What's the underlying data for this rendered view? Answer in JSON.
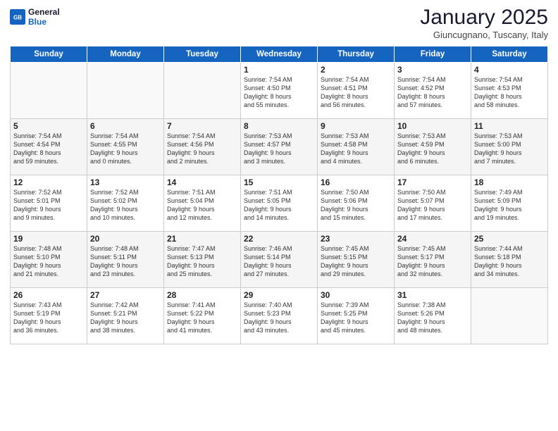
{
  "header": {
    "logo_line1": "General",
    "logo_line2": "Blue",
    "month": "January 2025",
    "location": "Giuncugnano, Tuscany, Italy"
  },
  "days_of_week": [
    "Sunday",
    "Monday",
    "Tuesday",
    "Wednesday",
    "Thursday",
    "Friday",
    "Saturday"
  ],
  "weeks": [
    [
      {
        "day": "",
        "info": ""
      },
      {
        "day": "",
        "info": ""
      },
      {
        "day": "",
        "info": ""
      },
      {
        "day": "1",
        "info": "Sunrise: 7:54 AM\nSunset: 4:50 PM\nDaylight: 8 hours\nand 55 minutes."
      },
      {
        "day": "2",
        "info": "Sunrise: 7:54 AM\nSunset: 4:51 PM\nDaylight: 8 hours\nand 56 minutes."
      },
      {
        "day": "3",
        "info": "Sunrise: 7:54 AM\nSunset: 4:52 PM\nDaylight: 8 hours\nand 57 minutes."
      },
      {
        "day": "4",
        "info": "Sunrise: 7:54 AM\nSunset: 4:53 PM\nDaylight: 8 hours\nand 58 minutes."
      }
    ],
    [
      {
        "day": "5",
        "info": "Sunrise: 7:54 AM\nSunset: 4:54 PM\nDaylight: 8 hours\nand 59 minutes."
      },
      {
        "day": "6",
        "info": "Sunrise: 7:54 AM\nSunset: 4:55 PM\nDaylight: 9 hours\nand 0 minutes."
      },
      {
        "day": "7",
        "info": "Sunrise: 7:54 AM\nSunset: 4:56 PM\nDaylight: 9 hours\nand 2 minutes."
      },
      {
        "day": "8",
        "info": "Sunrise: 7:53 AM\nSunset: 4:57 PM\nDaylight: 9 hours\nand 3 minutes."
      },
      {
        "day": "9",
        "info": "Sunrise: 7:53 AM\nSunset: 4:58 PM\nDaylight: 9 hours\nand 4 minutes."
      },
      {
        "day": "10",
        "info": "Sunrise: 7:53 AM\nSunset: 4:59 PM\nDaylight: 9 hours\nand 6 minutes."
      },
      {
        "day": "11",
        "info": "Sunrise: 7:53 AM\nSunset: 5:00 PM\nDaylight: 9 hours\nand 7 minutes."
      }
    ],
    [
      {
        "day": "12",
        "info": "Sunrise: 7:52 AM\nSunset: 5:01 PM\nDaylight: 9 hours\nand 9 minutes."
      },
      {
        "day": "13",
        "info": "Sunrise: 7:52 AM\nSunset: 5:02 PM\nDaylight: 9 hours\nand 10 minutes."
      },
      {
        "day": "14",
        "info": "Sunrise: 7:51 AM\nSunset: 5:04 PM\nDaylight: 9 hours\nand 12 minutes."
      },
      {
        "day": "15",
        "info": "Sunrise: 7:51 AM\nSunset: 5:05 PM\nDaylight: 9 hours\nand 14 minutes."
      },
      {
        "day": "16",
        "info": "Sunrise: 7:50 AM\nSunset: 5:06 PM\nDaylight: 9 hours\nand 15 minutes."
      },
      {
        "day": "17",
        "info": "Sunrise: 7:50 AM\nSunset: 5:07 PM\nDaylight: 9 hours\nand 17 minutes."
      },
      {
        "day": "18",
        "info": "Sunrise: 7:49 AM\nSunset: 5:09 PM\nDaylight: 9 hours\nand 19 minutes."
      }
    ],
    [
      {
        "day": "19",
        "info": "Sunrise: 7:48 AM\nSunset: 5:10 PM\nDaylight: 9 hours\nand 21 minutes."
      },
      {
        "day": "20",
        "info": "Sunrise: 7:48 AM\nSunset: 5:11 PM\nDaylight: 9 hours\nand 23 minutes."
      },
      {
        "day": "21",
        "info": "Sunrise: 7:47 AM\nSunset: 5:13 PM\nDaylight: 9 hours\nand 25 minutes."
      },
      {
        "day": "22",
        "info": "Sunrise: 7:46 AM\nSunset: 5:14 PM\nDaylight: 9 hours\nand 27 minutes."
      },
      {
        "day": "23",
        "info": "Sunrise: 7:45 AM\nSunset: 5:15 PM\nDaylight: 9 hours\nand 29 minutes."
      },
      {
        "day": "24",
        "info": "Sunrise: 7:45 AM\nSunset: 5:17 PM\nDaylight: 9 hours\nand 32 minutes."
      },
      {
        "day": "25",
        "info": "Sunrise: 7:44 AM\nSunset: 5:18 PM\nDaylight: 9 hours\nand 34 minutes."
      }
    ],
    [
      {
        "day": "26",
        "info": "Sunrise: 7:43 AM\nSunset: 5:19 PM\nDaylight: 9 hours\nand 36 minutes."
      },
      {
        "day": "27",
        "info": "Sunrise: 7:42 AM\nSunset: 5:21 PM\nDaylight: 9 hours\nand 38 minutes."
      },
      {
        "day": "28",
        "info": "Sunrise: 7:41 AM\nSunset: 5:22 PM\nDaylight: 9 hours\nand 41 minutes."
      },
      {
        "day": "29",
        "info": "Sunrise: 7:40 AM\nSunset: 5:23 PM\nDaylight: 9 hours\nand 43 minutes."
      },
      {
        "day": "30",
        "info": "Sunrise: 7:39 AM\nSunset: 5:25 PM\nDaylight: 9 hours\nand 45 minutes."
      },
      {
        "day": "31",
        "info": "Sunrise: 7:38 AM\nSunset: 5:26 PM\nDaylight: 9 hours\nand 48 minutes."
      },
      {
        "day": "",
        "info": ""
      }
    ]
  ]
}
